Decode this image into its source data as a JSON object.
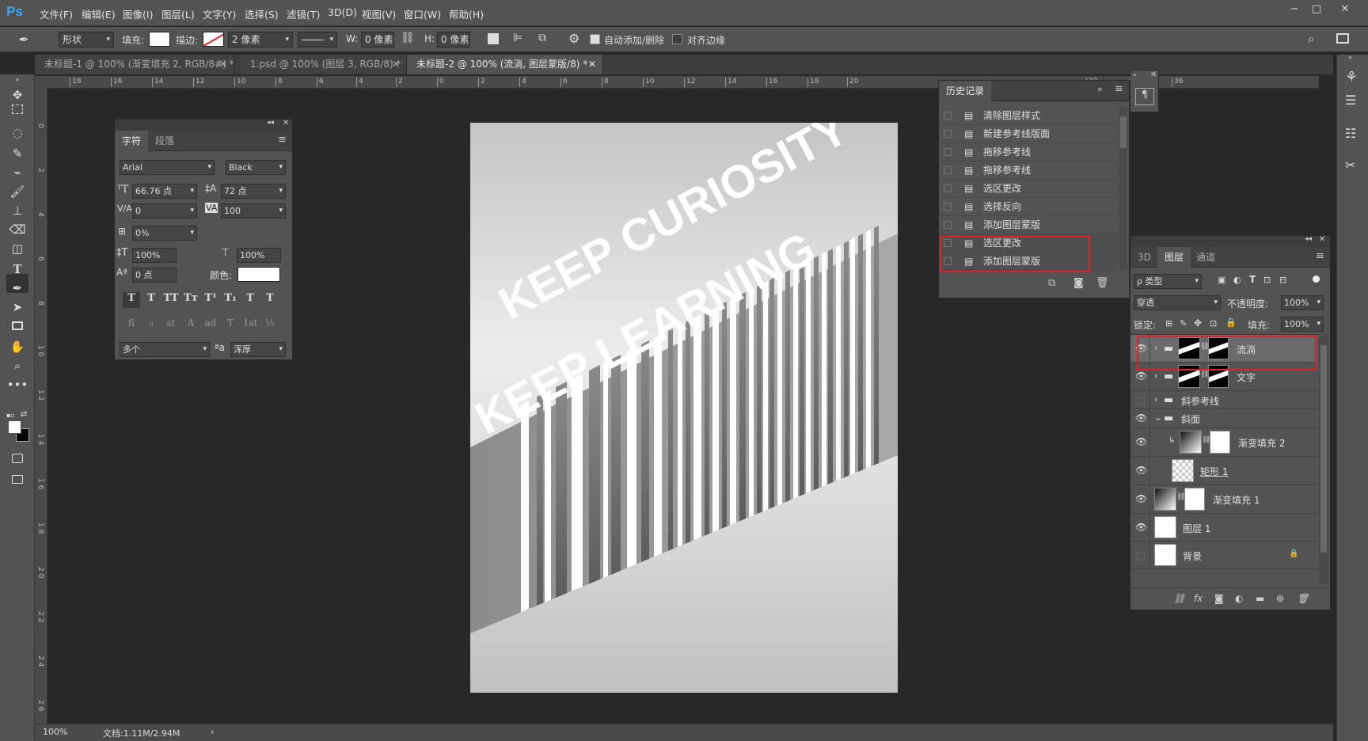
{
  "app": {
    "logo": "Ps",
    "accent": "#31a8ff"
  },
  "menu": [
    "文件(F)",
    "编辑(E)",
    "图像(I)",
    "图层(L)",
    "文字(Y)",
    "选择(S)",
    "滤镜(T)",
    "3D(D)",
    "视图(V)",
    "窗口(W)",
    "帮助(H)"
  ],
  "window_controls": [
    "−",
    "□",
    "✕"
  ],
  "options": {
    "tool_mode": "形状",
    "fill_label": "填充:",
    "stroke_label": "描边:",
    "stroke_width": "2 像素",
    "w_label": "W:",
    "w_value": "0 像素",
    "h_label": "H:",
    "h_value": "0 像素",
    "auto_add_delete": "自动添加/删除",
    "align_edges": "对齐边缘"
  },
  "tabs": [
    {
      "label": "未标题-1 @ 100% (渐变填充 2, RGB/8#) *"
    },
    {
      "label": "1.psd @ 100% (图层 3, RGB/8) *"
    },
    {
      "label": "未标题-2 @ 100% (流淌, 图层蒙版/8) *"
    }
  ],
  "rulers": {
    "h": [
      "18",
      "16",
      "14",
      "12",
      "10",
      "8",
      "6",
      "4",
      "2",
      "0",
      "2",
      "4",
      "6",
      "8",
      "10",
      "12",
      "14",
      "16",
      "18",
      "20",
      "32",
      "34",
      "36"
    ],
    "v": [
      "0",
      "2",
      "4",
      "6",
      "8",
      "1 0",
      "1 2",
      "1 4",
      "1 6",
      "1 8",
      "2 0",
      "2 2",
      "2 4",
      "2 6"
    ]
  },
  "char_panel": {
    "tabs": [
      "字符",
      "段落"
    ],
    "font_family": "Arial",
    "font_style": "Black",
    "font_size": "66.76 点",
    "leading": "72 点",
    "kerning": "0",
    "tracking": "100",
    "tsume": "0%",
    "vscale": "100%",
    "hscale": "100%",
    "baseline": "0 点",
    "color_label": "颜色:",
    "style_buttons": [
      "T",
      "T",
      "TT",
      "Tт",
      "T¹",
      "T₁",
      "T",
      "T"
    ],
    "opentype_buttons": [
      "fi",
      "ℴ",
      "st",
      "A",
      "ad",
      "T",
      "1st",
      "½"
    ],
    "language": "多个",
    "aa_label": "ªa",
    "antialias": "浑厚"
  },
  "canvas": {
    "line1": "KEEP CURIOSITY",
    "line2": "KEEP LEARNING"
  },
  "history": {
    "title": "历史记录",
    "items": [
      "清除图层样式",
      "新建参考线版面",
      "拖移参考线",
      "拖移参考线",
      "选区更改",
      "选择反向",
      "添加图层蒙版",
      "选区更改",
      "添加图层蒙版"
    ]
  },
  "layers": {
    "tabs": [
      "3D",
      "图层",
      "通道"
    ],
    "filter_kind": "ρ 类型",
    "blend_mode": "穿透",
    "opacity_label": "不透明度:",
    "opacity": "100%",
    "lock_label": "锁定:",
    "fill_label": "填充:",
    "fill": "100%",
    "items": [
      {
        "name": "流淌",
        "visible": true
      },
      {
        "name": "文字",
        "visible": true
      },
      {
        "name": "斜参考线",
        "visible": false
      },
      {
        "name": "斜面",
        "visible": true
      },
      {
        "name": "渐变填充 2",
        "visible": true
      },
      {
        "name": "矩形 1",
        "visible": true
      },
      {
        "name": "渐变填充 1",
        "visible": true
      },
      {
        "name": "图层 1",
        "visible": true
      },
      {
        "name": "背景",
        "visible": false
      }
    ],
    "footer_icons": [
      "link-icon",
      "fx-icon",
      "mask-icon",
      "adjustment-icon",
      "group-icon",
      "new-layer-icon",
      "trash-icon"
    ],
    "fx_label": "fx"
  },
  "status": {
    "zoom": "100%",
    "doc": "文档:1.11M/2.94M"
  },
  "colors": {
    "highlight": "#e0212a",
    "panel": "#535353",
    "workspace": "#282828"
  }
}
